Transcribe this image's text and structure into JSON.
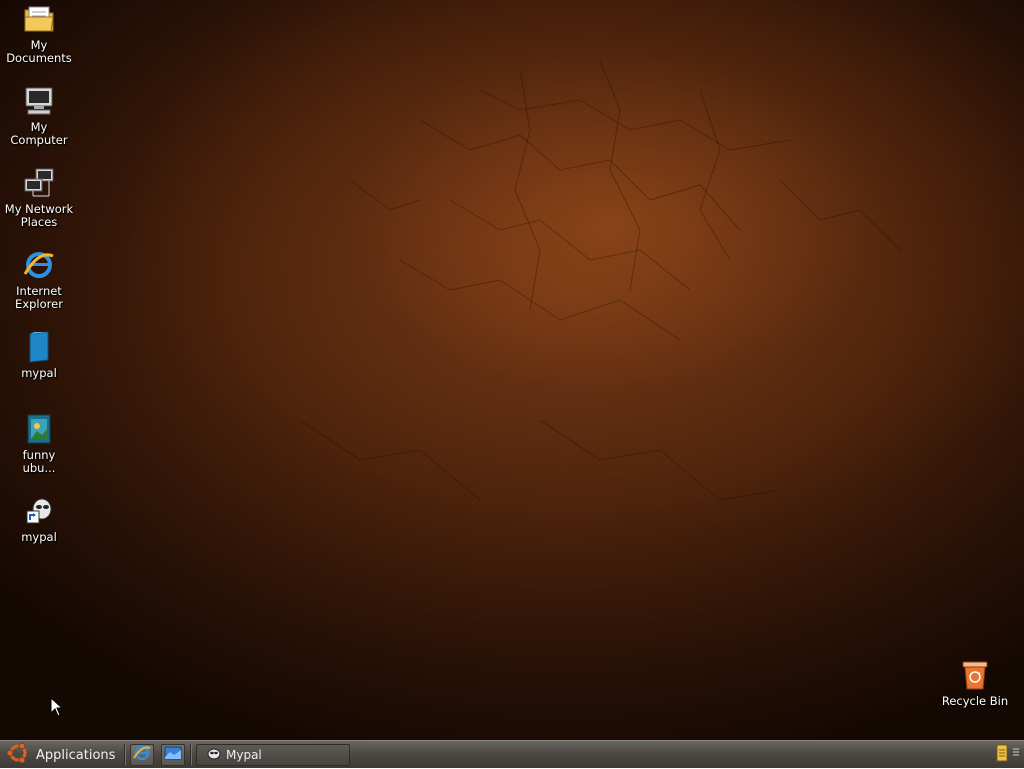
{
  "desktop": {
    "icons": [
      {
        "label": "My\nDocuments",
        "icon": "folder-documents-icon"
      },
      {
        "label": "My\nComputer",
        "icon": "computer-icon"
      },
      {
        "label": "My Network\nPlaces",
        "icon": "network-places-icon"
      },
      {
        "label": "Internet\nExplorer",
        "icon": "internet-explorer-icon"
      },
      {
        "label": "mypal",
        "icon": "mypal-blue-icon"
      },
      {
        "label": "funny\nubu...",
        "icon": "image-file-icon"
      },
      {
        "label": "mypal",
        "icon": "mypal-shortcut-icon"
      }
    ],
    "recycle_bin": {
      "label": "Recycle Bin",
      "icon": "recycle-bin-icon"
    }
  },
  "taskbar": {
    "applications_label": "Applications",
    "quick_launch": [
      "internet-explorer-icon",
      "show-desktop-icon"
    ],
    "tasks": [
      {
        "label": "Mypal",
        "icon": "mypal-icon"
      }
    ],
    "tray": [
      "notes-icon",
      "handle-icon"
    ]
  }
}
